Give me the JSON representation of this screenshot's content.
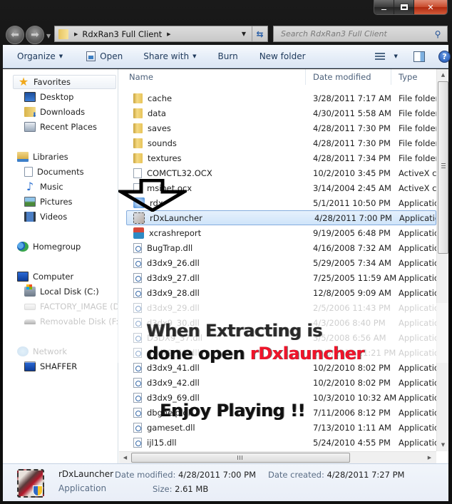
{
  "window": {
    "caption_buttons": {
      "minimize": "minimize",
      "maximize": "maximize",
      "close": "close"
    }
  },
  "navbar": {
    "breadcrumb": [
      "RdxRan3 Full Client"
    ],
    "search_placeholder": "Search RdxRan3 Full Client"
  },
  "toolbar": {
    "organize": "Organize",
    "open": "Open",
    "share_with": "Share with",
    "burn": "Burn",
    "new_folder": "New folder"
  },
  "sidebar": {
    "favorites": {
      "label": "Favorites",
      "items": [
        {
          "label": "Desktop"
        },
        {
          "label": "Downloads"
        },
        {
          "label": "Recent Places"
        }
      ]
    },
    "libraries": {
      "label": "Libraries",
      "items": [
        {
          "label": "Documents"
        },
        {
          "label": "Music"
        },
        {
          "label": "Pictures"
        },
        {
          "label": "Videos"
        }
      ]
    },
    "homegroup": {
      "label": "Homegroup"
    },
    "computer": {
      "label": "Computer",
      "items": [
        {
          "label": "Local Disk (C:)"
        },
        {
          "label": "FACTORY_IMAGE (D:)"
        },
        {
          "label": "Removable Disk (F:)"
        }
      ]
    },
    "network": {
      "label": "Network",
      "items": [
        {
          "label": "SHAFFER"
        }
      ]
    }
  },
  "file_list": {
    "columns": {
      "name": "Name",
      "date": "Date modified",
      "type": "Type"
    },
    "rows": [
      {
        "name": "cache",
        "date": "3/28/2011 7:17 AM",
        "type": "File folder",
        "icon": "folder"
      },
      {
        "name": "data",
        "date": "4/30/2011 5:58 AM",
        "type": "File folder",
        "icon": "folder"
      },
      {
        "name": "saves",
        "date": "4/28/2011 7:30 PM",
        "type": "File folder",
        "icon": "folder"
      },
      {
        "name": "sounds",
        "date": "4/28/2011 7:30 PM",
        "type": "File folder",
        "icon": "folder"
      },
      {
        "name": "textures",
        "date": "4/28/2011 7:34 PM",
        "type": "File folder",
        "icon": "folder"
      },
      {
        "name": "COMCTL32.OCX",
        "date": "10/2/2010 3:45 PM",
        "type": "ActiveX control",
        "icon": "ocx"
      },
      {
        "name": "msinet.ocx",
        "date": "3/14/2004 2:45 AM",
        "type": "ActiveX control",
        "icon": "ocx"
      },
      {
        "name": "rdx",
        "date": "5/1/2011 10:50 PM",
        "type": "Application",
        "icon": "app"
      },
      {
        "name": "rDxLauncher",
        "date": "4/28/2011 7:00 PM",
        "type": "Application",
        "icon": "launcher",
        "selected": true
      },
      {
        "name": "xcrashreport",
        "date": "9/19/2005 6:48 PM",
        "type": "Application",
        "icon": "crash"
      },
      {
        "name": "BugTrap.dll",
        "date": "4/16/2008 7:32 AM",
        "type": "Application extension",
        "icon": "dll"
      },
      {
        "name": "d3dx9_26.dll",
        "date": "5/29/2005 7:34 AM",
        "type": "Application extension",
        "icon": "dll"
      },
      {
        "name": "d3dx9_27.dll",
        "date": "7/25/2005 11:59 AM",
        "type": "Application extension",
        "icon": "dll"
      },
      {
        "name": "d3dx9_28.dll",
        "date": "12/8/2005 9:09 AM",
        "type": "Application extension",
        "icon": "dll"
      },
      {
        "name": "d3dx9_29.dll",
        "date": "2/5/2006 11:43 PM",
        "type": "Application extension",
        "icon": "dll",
        "dim": true
      },
      {
        "name": "d3dx9_30.dll",
        "date": "4/3/2006 8:40 PM",
        "type": "Application extension",
        "icon": "dll",
        "dim": true
      },
      {
        "name": "D3DX9_37.dll",
        "date": "3/5/2008 6:56 AM",
        "type": "Application extension",
        "icon": "dll",
        "dim": true
      },
      {
        "name": "d3dx9_40.dll",
        "date": "10/3/2010 11:21 PM",
        "type": "Application extension",
        "icon": "dll",
        "dim": true
      },
      {
        "name": "d3dx9_41.dll",
        "date": "10/2/2010 8:02 PM",
        "type": "Application extension",
        "icon": "dll"
      },
      {
        "name": "d3dx9_42.dll",
        "date": "10/2/2010 8:02 PM",
        "type": "Application extension",
        "icon": "dll"
      },
      {
        "name": "d3dx9_69.dll",
        "date": "10/3/2010 10:32 AM",
        "type": "Application extension",
        "icon": "dll"
      },
      {
        "name": "dbghelp.dll",
        "date": "7/11/2006 8:12 PM",
        "type": "Application extension",
        "icon": "dll"
      },
      {
        "name": "gameset.dll",
        "date": "7/13/2010 1:11 AM",
        "type": "Application extension",
        "icon": "dll"
      },
      {
        "name": "ijl15.dll",
        "date": "5/24/2010 4:55 PM",
        "type": "Application extension",
        "icon": "dll"
      }
    ]
  },
  "overlay": {
    "line1": "When Extracting is",
    "line2_prefix": "done open ",
    "line2_accent": "rDxlauncher",
    "line3": "Enjoy Playing !!",
    "accent_color": "#f0142a"
  },
  "details_pane": {
    "name": "rDxLauncher",
    "kind": "Application",
    "date_modified_label": "Date modified:",
    "date_modified": "4/28/2011 7:00 PM",
    "date_created_label": "Date created:",
    "date_created": "4/28/2011 7:27 PM",
    "size_label": "Size:",
    "size": "2.61 MB"
  }
}
